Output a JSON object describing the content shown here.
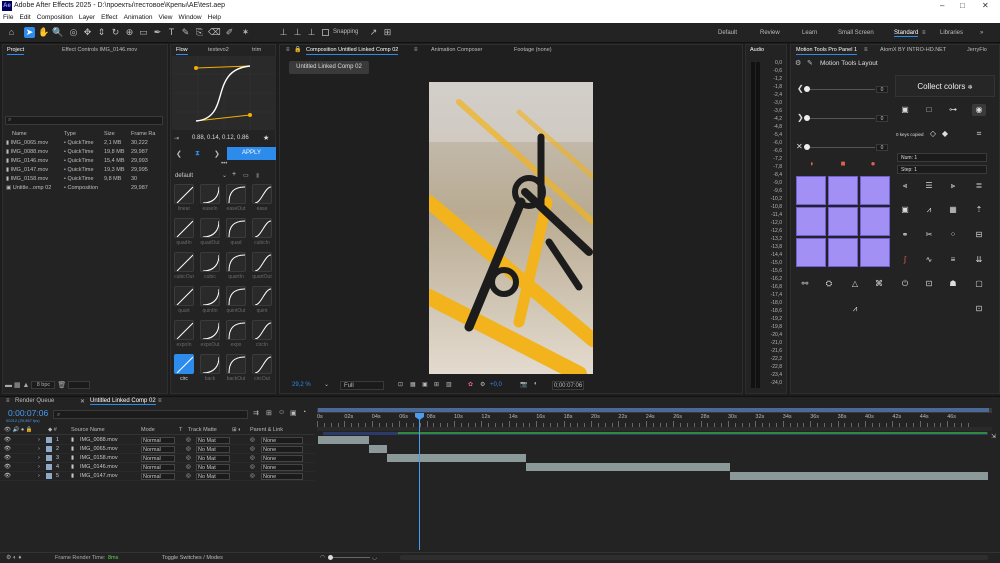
{
  "app": {
    "title": "Adobe After Effects 2025 - D:\\проекты\\тестовое\\Крепы\\AE\\test.aep"
  },
  "menu": [
    "File",
    "Edit",
    "Composition",
    "Layer",
    "Effect",
    "Animation",
    "View",
    "Window",
    "Help"
  ],
  "toolbar": {
    "snapping": "Snapping",
    "workspaces": [
      "Default",
      "Review",
      "Learn",
      "Small Screen",
      "Standard",
      "Libraries"
    ]
  },
  "project": {
    "tab": "Project",
    "effects_tab": "Effect Controls IMG_0146.mov",
    "search_placeholder": "",
    "columns": [
      "Name",
      "Type",
      "Size",
      "Frame Ra"
    ],
    "rows": [
      {
        "name": "IMG_0065.mov",
        "type": "QuickTime",
        "size": "2,1 MB",
        "fps": "30,222"
      },
      {
        "name": "IMG_0088.mov",
        "type": "QuickTime",
        "size": "19,8 MB",
        "fps": "29,987"
      },
      {
        "name": "IMG_0146.mov",
        "type": "QuickTime",
        "size": "15,4 MB",
        "fps": "29,993"
      },
      {
        "name": "IMG_0147.mov",
        "type": "QuickTime",
        "size": "19,3 MB",
        "fps": "29,995"
      },
      {
        "name": "IMG_0158.mov",
        "type": "QuickTime",
        "size": "9,8 MB",
        "fps": "30"
      },
      {
        "name": "Untitle...omp 02",
        "type": "Composition",
        "size": "",
        "fps": "29,987"
      }
    ],
    "bpc": "8 bpc"
  },
  "flow": {
    "tabs": [
      "Flow",
      "textevo2",
      "trim"
    ],
    "values": "0.88, 0.14, 0.12, 0.86",
    "apply": "APPLY",
    "preset": "default",
    "easings": [
      "linear",
      "easeIn",
      "easeOut",
      "ease",
      "quadIn",
      "quadOut",
      "quad",
      "cubicIn",
      "cubicOut",
      "cubic",
      "quartIn",
      "quartOut",
      "quart",
      "quintIn",
      "quintOut",
      "quint",
      "expoIn",
      "expoOut",
      "expo",
      "circIn",
      "circ",
      "back",
      "backOut",
      "circOut"
    ]
  },
  "comp": {
    "tab": "Composition Untitled Linked Comp 02",
    "tabs2": [
      "Animation Composer",
      "Footage (none)"
    ],
    "chip": "Untitled Linked Comp 02",
    "zoom": "29,2 %",
    "quality": "Full",
    "exposure": "+0,0",
    "time": "0;00:07:06"
  },
  "audio": {
    "tab": "Audio",
    "levels": [
      "0,0",
      "-0,6",
      "-1,2",
      "-1,8",
      "-2,4",
      "-3,0",
      "-3,6",
      "-4,2",
      "-4,8",
      "-5,4",
      "-6,0",
      "-6,6",
      "-7,2",
      "-7,8",
      "-8,4",
      "-9,0",
      "-9,6",
      "-10,2",
      "-10,8",
      "-11,4",
      "-12,0",
      "-12,6",
      "-13,2",
      "-13,8",
      "-14,4",
      "-15,0",
      "-15,6",
      "-16,2",
      "-16,8",
      "-17,4",
      "-18,0",
      "-18,6",
      "-19,2",
      "-19,8",
      "-20,4",
      "-21,0",
      "-21,6",
      "-22,2",
      "-22,8",
      "-23,4",
      "-24,0"
    ]
  },
  "motion": {
    "tabs": [
      "Motion Tools Pro Panel 1",
      "AtomX BY INTRO-HD.NET",
      "JerryFlo"
    ],
    "title": "Motion Tools Layout",
    "collect": "Collect colors",
    "keys": "0 keys copied",
    "num": "Num: 1",
    "step": "Step: 1",
    "slider": "0"
  },
  "timeline": {
    "render_queue": "Render Queue",
    "comp_tab": "Untitled Linked Comp 02",
    "time": "0:00:07:06",
    "fps": "00212 (29,987 fps)",
    "columns": [
      "Source Name",
      "Mode",
      "T",
      "Track Matte",
      "Parent & Link"
    ],
    "layers": [
      {
        "num": "1",
        "name": "IMG_0088.mov",
        "mode": "Normal",
        "matte": "No Mat",
        "parent": "None"
      },
      {
        "num": "2",
        "name": "IMG_0065.mov",
        "mode": "Normal",
        "matte": "No Mat",
        "parent": "None"
      },
      {
        "num": "3",
        "name": "IMG_0158.mov",
        "mode": "Normal",
        "matte": "No Mat",
        "parent": "None"
      },
      {
        "num": "4",
        "name": "IMG_0146.mov",
        "mode": "Normal",
        "matte": "No Mat",
        "parent": "None"
      },
      {
        "num": "5",
        "name": "IMG_0147.mov",
        "mode": "Normal",
        "matte": "No Mat",
        "parent": "None"
      }
    ],
    "ruler": [
      "0s",
      "02s",
      "04s",
      "06s",
      "08s",
      "10s",
      "12s",
      "14s",
      "16s",
      "18s",
      "20s",
      "22s",
      "24s",
      "26s",
      "28s",
      "30s",
      "32s",
      "34s",
      "36s",
      "38s",
      "40s",
      "42s",
      "44s",
      "46s"
    ],
    "frame_render": "Frame Render Time:",
    "frame_ms": "8ms",
    "toggle": "Toggle Switches / Modes"
  },
  "colors": {
    "accent": "#2d8ceb",
    "purple": "#a390f5",
    "yellow": "#f0b000"
  }
}
